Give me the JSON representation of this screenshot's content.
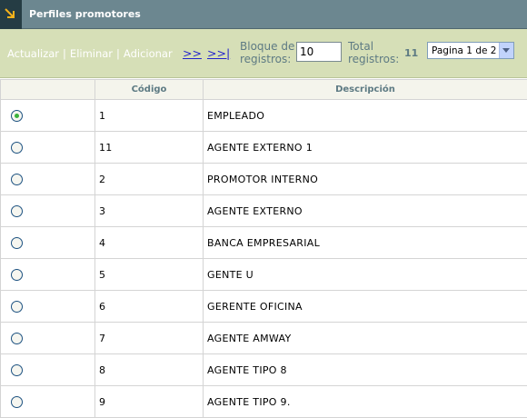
{
  "window": {
    "title": "Perfiles promotores"
  },
  "toolbar": {
    "actualizar": "Actualizar",
    "eliminar": "Eliminar",
    "adicionar": "Adicionar",
    "separator": "|",
    "next": ">>",
    "last": ">>|",
    "block_label_1": "Bloque de",
    "block_label_2": "registros:",
    "block_value": "10",
    "total_label_1": "Total",
    "total_label_2": "registros:",
    "total_value": "11",
    "page_select": "Pagina 1 de 2"
  },
  "table": {
    "headers": {
      "select": "",
      "codigo": "Código",
      "descripcion": "Descripción"
    },
    "rows": [
      {
        "codigo": "1",
        "descripcion": "EMPLEADO",
        "selected": true
      },
      {
        "codigo": "11",
        "descripcion": "AGENTE EXTERNO 1",
        "selected": false
      },
      {
        "codigo": "2",
        "descripcion": "PROMOTOR INTERNO",
        "selected": false
      },
      {
        "codigo": "3",
        "descripcion": "AGENTE EXTERNO",
        "selected": false
      },
      {
        "codigo": "4",
        "descripcion": "BANCA EMPRESARIAL",
        "selected": false
      },
      {
        "codigo": "5",
        "descripcion": "GENTE U",
        "selected": false
      },
      {
        "codigo": "6",
        "descripcion": "GERENTE OFICINA",
        "selected": false
      },
      {
        "codigo": "7",
        "descripcion": "AGENTE AMWAY",
        "selected": false
      },
      {
        "codigo": "8",
        "descripcion": "AGENTE TIPO 8",
        "selected": false
      },
      {
        "codigo": "9",
        "descripcion": "AGENTE TIPO 9.",
        "selected": false
      }
    ]
  },
  "colors": {
    "titlebar": "#6c8790",
    "toolbar": "#d6dfb7",
    "label": "#5d7a83",
    "radio_selected": "#3bb23b"
  }
}
